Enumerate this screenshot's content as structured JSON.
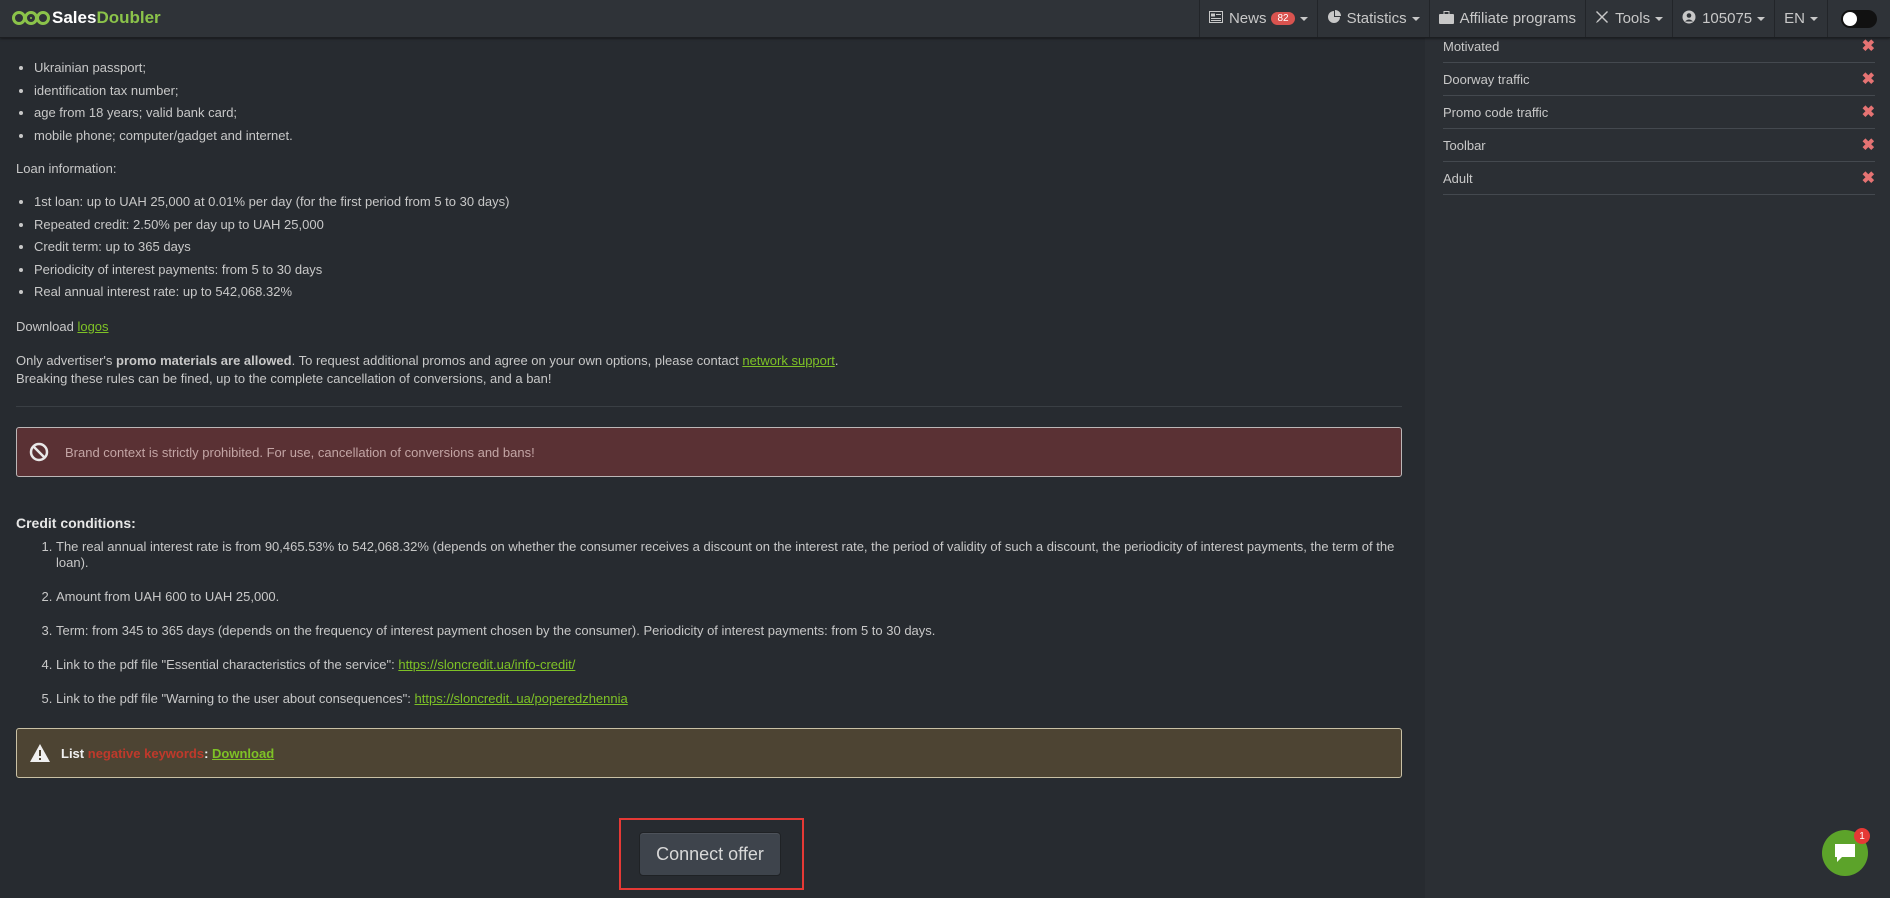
{
  "brand": {
    "part1": "Sales",
    "part2": "Doubler"
  },
  "nav": {
    "news_label": "News",
    "news_count": "82",
    "statistics_label": "Statistics",
    "affiliate_label": "Affiliate programs",
    "tools_label": "Tools",
    "account_id": "105075",
    "language": "EN"
  },
  "requirements_items": [
    "Ukrainian passport;",
    "identification tax number;",
    "age from 18 years; valid bank card;",
    "mobile phone; computer/gadget and internet."
  ],
  "loan_info_heading": "Loan information:",
  "loan_info_items": [
    "1st loan: up to UAH 25,000 at 0.01% per day (for the first period from 5 to 30 days)",
    "Repeated credit: 2.50% per day up to UAH 25,000",
    "Credit term: up to 365 days",
    "Periodicity of interest payments: from 5 to 30 days",
    "Real annual interest rate: up to 542,068.32%"
  ],
  "download_text": "Download",
  "download_link": "logos",
  "promo": {
    "prefix": "Only advertiser's",
    "bold": "promo materials are allowed",
    "middle": ". To request additional promos and agree on your own options, please contact",
    "link": "network support",
    "suffix": ".",
    "line2": "Breaking these rules can be fined, up to the complete cancellation of conversions, and a ban!"
  },
  "danger_alert": "Brand context is strictly prohibited. For use, cancellation of conversions and bans!",
  "credit_conditions_heading": "Credit conditions:",
  "credit_conditions": [
    {
      "text": "The real annual interest rate is from 90,465.53% to 542,068.32% (depends on whether the consumer receives a discount on the interest rate, the period of validity of such a discount, the periodicity of interest payments, the term of the loan).",
      "link": ""
    },
    {
      "text": "Amount from UAH 600 to UAH 25,000.",
      "link": ""
    },
    {
      "text": "Term: from 345 to 365 days (depends on the frequency of interest payment chosen by the consumer). Periodicity of interest payments: from 5 to 30 days.",
      "link": ""
    },
    {
      "text": "Link to the pdf file \"Essential characteristics of the service\": ",
      "link": "https://sloncredit.ua/info-credit/"
    },
    {
      "text": "Link to the pdf file \"Warning to the user about consequences\": ",
      "link": "https://sloncredit. ua/poperedzhennia"
    }
  ],
  "warning": {
    "list": "List",
    "hidden": "negative keywords",
    "colon": ":",
    "link": "Download"
  },
  "connect_button": "Connect offer",
  "traffic_items": [
    "Motivated",
    "Doorway traffic",
    "Promo code traffic",
    "Toolbar",
    "Adult"
  ],
  "chat_count": "1",
  "colors": {
    "accent": "#7ec226",
    "danger": "#e53935",
    "background": "#272b30"
  }
}
